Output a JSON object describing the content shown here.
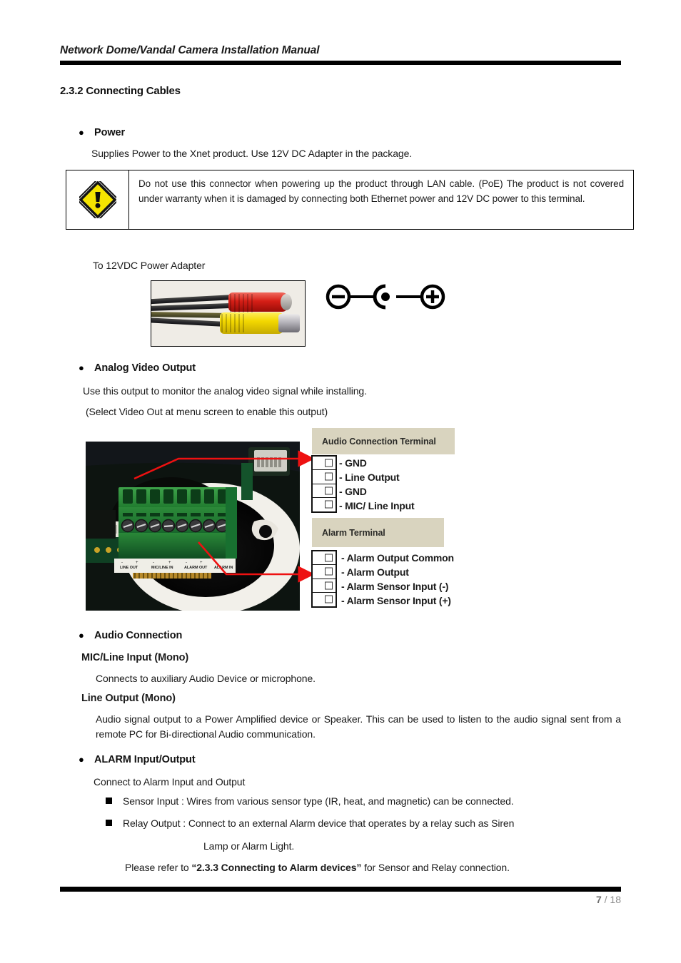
{
  "header": {
    "title": "Network Dome/Vandal Camera Installation Manual"
  },
  "section": {
    "heading": "2.3.2 Connecting Cables"
  },
  "power": {
    "bullet_label": "Power",
    "description": "Supplies Power to the Xnet product. Use 12V DC Adapter in the package.",
    "warning_icon": "warning-triangle-icon",
    "warning_text": "Do not use this connector when powering up the product through LAN cable. (PoE)   The product is not covered under warranty when it is damaged by connecting both Ethernet power and 12V DC power to this terminal.",
    "adapter_caption": "To 12VDC Power Adapter",
    "polarity_diagram": {
      "left_symbol": "minus-circle-icon",
      "center_symbol": "center-pin-icon",
      "right_symbol": "plus-circle-icon"
    }
  },
  "analog_video": {
    "bullet_label": "Analog Video Output",
    "line1": "Use this output to monitor the analog video signal while installing.",
    "line2": "(Select Video Out at menu screen to enable this output)"
  },
  "terminals": {
    "audio": {
      "header": "Audio Connection Terminal",
      "pins": [
        "- GND",
        "- Line Output",
        "- GND",
        "- MIC/ Line Input"
      ]
    },
    "alarm": {
      "header": "Alarm Terminal",
      "pins": [
        "- Alarm Output Common",
        "- Alarm Output",
        "- Alarm Sensor Input (-)",
        "- Alarm Sensor Input (+)"
      ]
    },
    "pcb_silkscreen": [
      "LINE OUT",
      "MIC/LINE IN",
      "ALARM OUT",
      "ALARM IN"
    ],
    "arrow_color": "#ee1111"
  },
  "audio_connection": {
    "bullet_label": "Audio Connection",
    "mic_heading": "MIC/Line Input (Mono)",
    "mic_text": "Connects to auxiliary Audio Device or microphone.",
    "line_heading": "Line Output (Mono)",
    "line_text": "Audio signal output to a Power Amplified device or Speaker. This can be used to listen to the audio signal sent from a remote PC for Bi-directional Audio communication."
  },
  "alarm_io": {
    "bullet_label": "ALARM Input/Output",
    "intro": "Connect to Alarm Input and Output",
    "items": [
      "Sensor Input : Wires from various sensor type (IR, heat, and magnetic) can be connected.",
      "Relay Output : Connect to an external Alarm device that operates by a relay such as Siren"
    ],
    "relay_continuation": "Lamp or Alarm Light.",
    "refer_prefix": "Please refer to ",
    "refer_bold": "“2.3.3 Connecting to Alarm devices”",
    "refer_suffix": " for Sensor and Relay connection."
  },
  "footer": {
    "current_page": "7",
    "separator": " / ",
    "total_pages": "18"
  },
  "colors": {
    "rule": "#000000",
    "callout_bg": "#d9d4bf",
    "arrow": "#ee1111",
    "warning_yellow": "#f5e400",
    "footer_text": "#8c8c8c"
  }
}
